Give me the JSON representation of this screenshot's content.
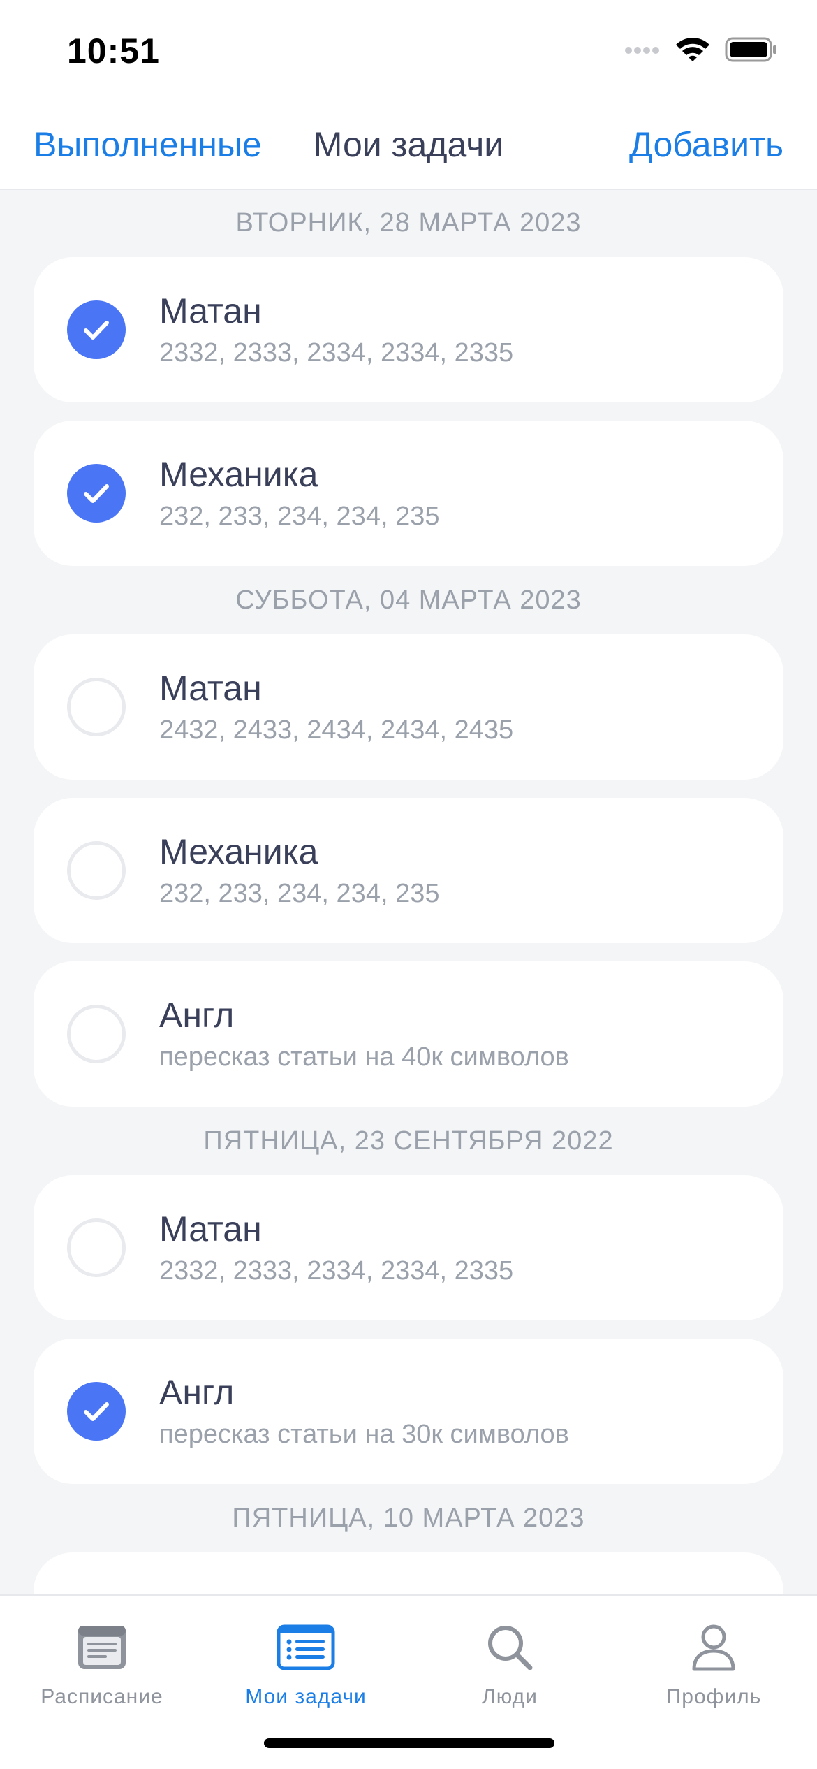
{
  "status_bar": {
    "time": "10:51",
    "icons": [
      "cellular-dots-icon",
      "wifi-icon",
      "battery-icon"
    ]
  },
  "nav": {
    "left_label": "Выполненные",
    "title": "Мои задачи",
    "right_label": "Добавить"
  },
  "sections": [
    {
      "header": "ВТОРНИК, 28 МАРТА 2023",
      "items": [
        {
          "title": "Матан",
          "subtitle": "2332, 2333, 2334, 2334, 2335",
          "done": true
        },
        {
          "title": "Механика",
          "subtitle": "232, 233, 234, 234, 235",
          "done": true
        }
      ]
    },
    {
      "header": "СУББОТА, 04 МАРТА 2023",
      "items": [
        {
          "title": "Матан",
          "subtitle": "2432, 2433, 2434, 2434, 2435",
          "done": false
        },
        {
          "title": "Механика",
          "subtitle": "232, 233, 234, 234, 235",
          "done": false
        },
        {
          "title": "Англ",
          "subtitle": "пересказ статьи на 40к символов",
          "done": false
        }
      ]
    },
    {
      "header": "ПЯТНИЦА, 23 СЕНТЯБРЯ 2022",
      "items": [
        {
          "title": "Матан",
          "subtitle": "2332, 2333, 2334, 2334, 2335",
          "done": false
        },
        {
          "title": "Англ",
          "subtitle": "пересказ статьи на 30к символов",
          "done": true
        }
      ]
    },
    {
      "header": "ПЯТНИЦА, 10 МАРТА 2023",
      "items": []
    }
  ],
  "tab_bar": {
    "tabs": [
      {
        "label": "Расписание",
        "icon": "schedule-icon",
        "active": false
      },
      {
        "label": "Мои задачи",
        "icon": "tasks-list-icon",
        "active": true
      },
      {
        "label": "Люди",
        "icon": "search-icon",
        "active": false
      },
      {
        "label": "Профиль",
        "icon": "profile-icon",
        "active": false
      }
    ]
  },
  "colors": {
    "accent": "#1a7ee6",
    "check_fill": "#4a76f5",
    "background": "#f4f5f7",
    "title_text": "#3a3f5a",
    "secondary_text": "#9aa1ab"
  }
}
